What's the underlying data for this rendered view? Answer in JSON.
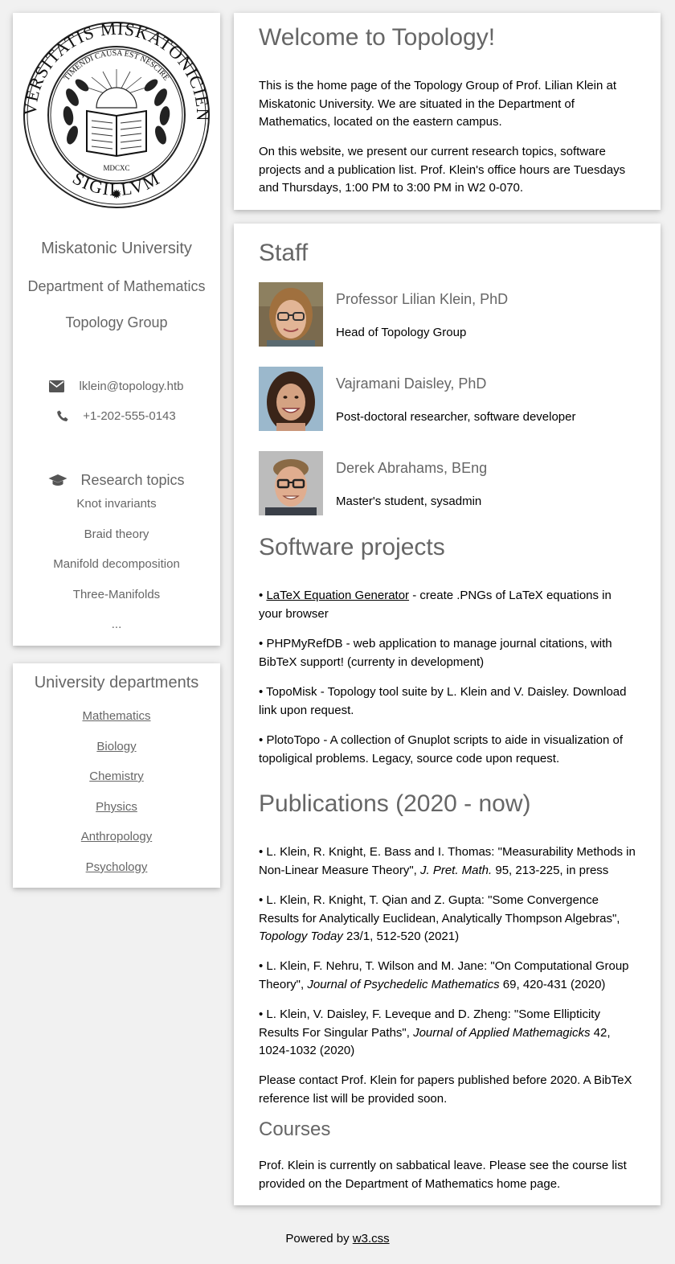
{
  "sidebar": {
    "seal": {
      "outer_text": "UNIVERSITATIS MISKATONICIENSIS",
      "bottom_text": "SIGILLVM",
      "motto": "TIMENDI CAUSA EST NESCIRE",
      "year": "MDCXC"
    },
    "university": "Miskatonic University",
    "department": "Department of Mathematics",
    "group": "Topology Group",
    "email": "lklein@topology.htb",
    "phone": "+1-202-555-0143",
    "research_heading": "Research topics",
    "topics": [
      "Knot invariants",
      "Braid theory",
      "Manifold decomposition",
      "Three-Manifolds",
      "..."
    ]
  },
  "departments": {
    "heading": "University departments",
    "items": [
      "Mathematics",
      "Biology",
      "Chemistry",
      "Physics",
      "Anthropology",
      "Psychology"
    ]
  },
  "welcome": {
    "title": "Welcome to Topology!",
    "p1": "This is the home page of the Topology Group of Prof. Lilian Klein at Miskatonic University. We are situated in the Department of Mathematics, located on the eastern campus.",
    "p2": "On this website, we present our current research topics, software projects and a publication list. Prof. Klein's office hours are Tuesdays and Thursdays, 1:00 PM to 3:00 PM in W2 0-070."
  },
  "staff": {
    "heading": "Staff",
    "members": [
      {
        "name": "Professor Lilian Klein, PhD",
        "role": "Head of Topology Group"
      },
      {
        "name": "Vajramani Daisley, PhD",
        "role": "Post-doctoral researcher, software developer"
      },
      {
        "name": "Derek Abrahams, BEng",
        "role": "Master's student, sysadmin"
      }
    ]
  },
  "software": {
    "heading": "Software projects",
    "items": [
      {
        "bullet": "•",
        "link": "LaTeX Equation Generator",
        "text": " - create .PNGs of LaTeX equations in your browser"
      },
      {
        "bullet": "•",
        "text": "PHPMyRefDB - web application to manage journal citations, with BibTeX support! (currenty in development)"
      },
      {
        "bullet": "•",
        "text": "TopoMisk - Topology tool suite by L. Klein and V. Daisley. Download link upon request."
      },
      {
        "bullet": "•",
        "text": "PlotoTopo - A collection of Gnuplot scripts to aide in visualization of topoligical problems. Legacy, source code upon request."
      }
    ]
  },
  "publications": {
    "heading": "Publications (2020 - now)",
    "items": [
      {
        "pre": "• L. Klein, R. Knight, E. Bass and I. Thomas: \"Measurability Methods in Non-Linear Measure Theory\", ",
        "journal": "J. Pret. Math.",
        "post": " 95, 213-225, in press"
      },
      {
        "pre": "• L. Klein, R. Knight, T. Qian and Z. Gupta: \"Some Convergence Results for Analytically Euclidean, Analytically Thompson Algebras\", ",
        "journal": "Topology Today",
        "post": " 23/1, 512-520 (2021)"
      },
      {
        "pre": "• L. Klein, F. Nehru, T. Wilson and M. Jane: \"On Computational Group Theory\", ",
        "journal": "Journal of Psychedelic Mathematics",
        "post": " 69, 420-431 (2020)"
      },
      {
        "pre": "• L. Klein, V. Daisley, F. Leveque and D. Zheng: \"Some Ellipticity Results For Singular Paths\", ",
        "journal": "Journal of Applied Mathemagicks",
        "post": " 42, 1024-1032 (2020)"
      }
    ],
    "note": "Please contact Prof. Klein for papers published before 2020. A BibTeX reference list will be provided soon."
  },
  "courses": {
    "heading": "Courses",
    "text": "Prof. Klein is currently on sabbatical leave. Please see the course list provided on the Department of Mathematics home page."
  },
  "footer": {
    "prefix": "Powered by ",
    "link": "w3.css"
  }
}
